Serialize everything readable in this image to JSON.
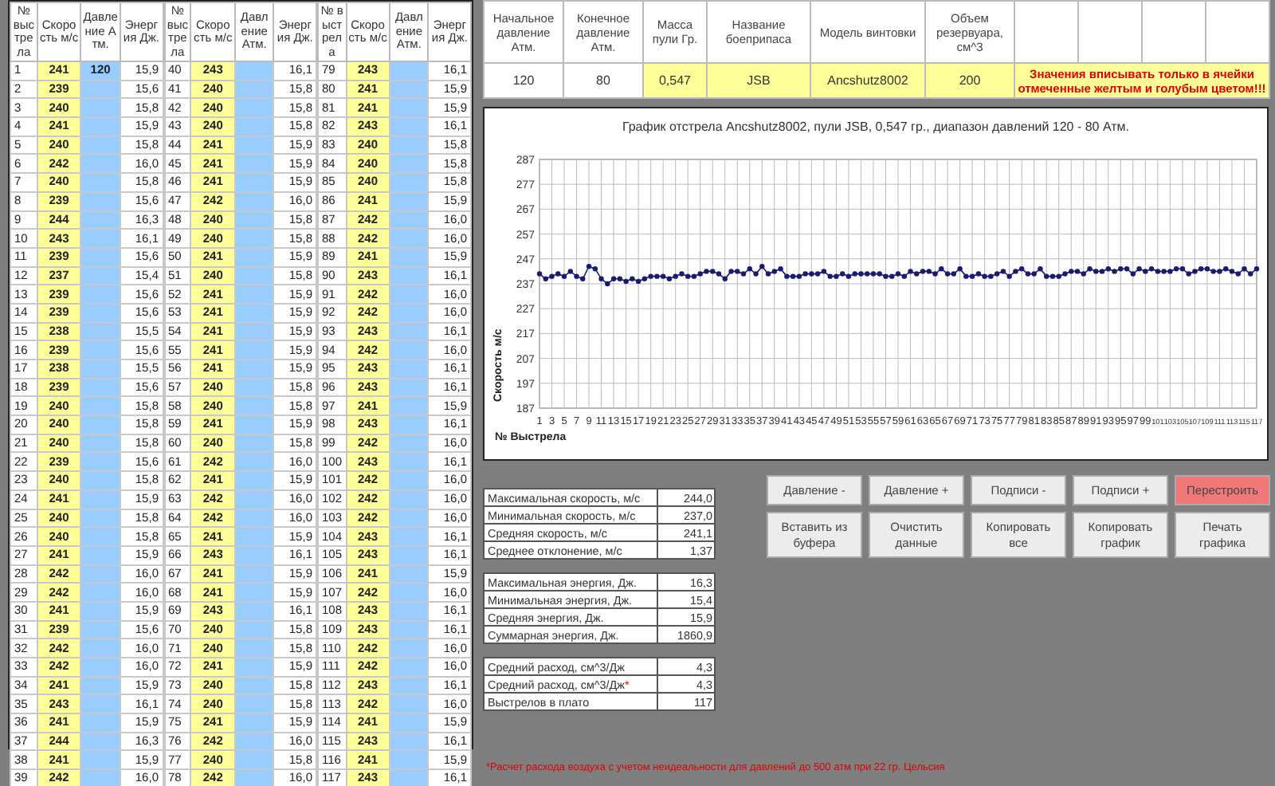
{
  "shot_table": {
    "groups": [
      {
        "columns": [
          {
            "label": "№ выстрела",
            "kind": "number"
          },
          {
            "label": "Скорость м/с",
            "kind": "speed",
            "color": "#ffff99"
          },
          {
            "label": "Давление Атм.",
            "kind": "pressure",
            "color": "#99ccff"
          },
          {
            "label": "Энергия Дж.",
            "kind": "energy"
          }
        ],
        "rows": [
          {
            "no": "1",
            "speed": "241",
            "pressure": "120",
            "energy": "15,9"
          },
          {
            "no": "2",
            "speed": "239",
            "energy": "15,6"
          },
          {
            "no": "3",
            "speed": "240",
            "energy": "15,8"
          },
          {
            "no": "4",
            "speed": "241",
            "energy": "15,9"
          },
          {
            "no": "5",
            "speed": "240",
            "energy": "15,8"
          },
          {
            "no": "6",
            "speed": "242",
            "energy": "16,0"
          },
          {
            "no": "7",
            "speed": "240",
            "energy": "15,8"
          },
          {
            "no": "8",
            "speed": "239",
            "energy": "15,6"
          },
          {
            "no": "9",
            "speed": "244",
            "energy": "16,3"
          },
          {
            "no": "10",
            "speed": "243",
            "energy": "16,1"
          },
          {
            "no": "11",
            "speed": "239",
            "energy": "15,6"
          },
          {
            "no": "12",
            "speed": "237",
            "energy": "15,4"
          },
          {
            "no": "13",
            "speed": "239",
            "energy": "15,6"
          },
          {
            "no": "14",
            "speed": "239",
            "energy": "15,6"
          },
          {
            "no": "15",
            "speed": "238",
            "energy": "15,5"
          },
          {
            "no": "16",
            "speed": "239",
            "energy": "15,6"
          },
          {
            "no": "17",
            "speed": "238",
            "energy": "15,5"
          },
          {
            "no": "18",
            "speed": "239",
            "energy": "15,6"
          },
          {
            "no": "19",
            "speed": "240",
            "energy": "15,8"
          },
          {
            "no": "20",
            "speed": "240",
            "energy": "15,8"
          },
          {
            "no": "21",
            "speed": "240",
            "energy": "15,8"
          },
          {
            "no": "22",
            "speed": "239",
            "energy": "15,6"
          },
          {
            "no": "23",
            "speed": "240",
            "energy": "15,8"
          },
          {
            "no": "24",
            "speed": "241",
            "energy": "15,9"
          },
          {
            "no": "25",
            "speed": "240",
            "energy": "15,8"
          },
          {
            "no": "26",
            "speed": "240",
            "energy": "15,8"
          },
          {
            "no": "27",
            "speed": "241",
            "energy": "15,9"
          },
          {
            "no": "28",
            "speed": "242",
            "energy": "16,0"
          },
          {
            "no": "29",
            "speed": "242",
            "energy": "16,0"
          },
          {
            "no": "30",
            "speed": "241",
            "energy": "15,9"
          },
          {
            "no": "31",
            "speed": "239",
            "energy": "15,6"
          },
          {
            "no": "32",
            "speed": "242",
            "energy": "16,0"
          },
          {
            "no": "33",
            "speed": "242",
            "energy": "16,0"
          },
          {
            "no": "34",
            "speed": "241",
            "energy": "15,9"
          },
          {
            "no": "35",
            "speed": "243",
            "energy": "16,1"
          },
          {
            "no": "36",
            "speed": "241",
            "energy": "15,9"
          },
          {
            "no": "37",
            "speed": "244",
            "energy": "16,3"
          },
          {
            "no": "38",
            "speed": "241",
            "energy": "15,9"
          },
          {
            "no": "39",
            "speed": "242",
            "energy": "16,0"
          }
        ]
      },
      {
        "columns": [
          {
            "label": "№ выстрела",
            "kind": "number"
          },
          {
            "label": "Скорость м/с",
            "kind": "speed",
            "color": "#ffff99"
          },
          {
            "label": "Давление Атм.",
            "kind": "pressure",
            "color": "#99ccff"
          },
          {
            "label": "Энергия Дж.",
            "kind": "energy"
          }
        ],
        "rows": [
          {
            "no": "40",
            "speed": "243",
            "energy": "16,1"
          },
          {
            "no": "41",
            "speed": "240",
            "energy": "15,8"
          },
          {
            "no": "42",
            "speed": "240",
            "energy": "15,8"
          },
          {
            "no": "43",
            "speed": "240",
            "energy": "15,8"
          },
          {
            "no": "44",
            "speed": "241",
            "energy": "15,9"
          },
          {
            "no": "45",
            "speed": "241",
            "energy": "15,9"
          },
          {
            "no": "46",
            "speed": "241",
            "energy": "15,9"
          },
          {
            "no": "47",
            "speed": "242",
            "energy": "16,0"
          },
          {
            "no": "48",
            "speed": "240",
            "energy": "15,8"
          },
          {
            "no": "49",
            "speed": "240",
            "energy": "15,8"
          },
          {
            "no": "50",
            "speed": "241",
            "energy": "15,9"
          },
          {
            "no": "51",
            "speed": "240",
            "energy": "15,8"
          },
          {
            "no": "52",
            "speed": "241",
            "energy": "15,9"
          },
          {
            "no": "53",
            "speed": "241",
            "energy": "15,9"
          },
          {
            "no": "54",
            "speed": "241",
            "energy": "15,9"
          },
          {
            "no": "55",
            "speed": "241",
            "energy": "15,9"
          },
          {
            "no": "56",
            "speed": "241",
            "energy": "15,9"
          },
          {
            "no": "57",
            "speed": "240",
            "energy": "15,8"
          },
          {
            "no": "58",
            "speed": "240",
            "energy": "15,8"
          },
          {
            "no": "59",
            "speed": "241",
            "energy": "15,9"
          },
          {
            "no": "60",
            "speed": "240",
            "energy": "15,8"
          },
          {
            "no": "61",
            "speed": "242",
            "energy": "16,0"
          },
          {
            "no": "62",
            "speed": "241",
            "energy": "15,9"
          },
          {
            "no": "63",
            "speed": "242",
            "energy": "16,0"
          },
          {
            "no": "64",
            "speed": "242",
            "energy": "16,0"
          },
          {
            "no": "65",
            "speed": "241",
            "energy": "15,9"
          },
          {
            "no": "66",
            "speed": "243",
            "energy": "16,1"
          },
          {
            "no": "67",
            "speed": "241",
            "energy": "15,9"
          },
          {
            "no": "68",
            "speed": "241",
            "energy": "15,9"
          },
          {
            "no": "69",
            "speed": "243",
            "energy": "16,1"
          },
          {
            "no": "70",
            "speed": "240",
            "energy": "15,8"
          },
          {
            "no": "71",
            "speed": "240",
            "energy": "15,8"
          },
          {
            "no": "72",
            "speed": "241",
            "energy": "15,9"
          },
          {
            "no": "73",
            "speed": "240",
            "energy": "15,8"
          },
          {
            "no": "74",
            "speed": "240",
            "energy": "15,8"
          },
          {
            "no": "75",
            "speed": "241",
            "energy": "15,9"
          },
          {
            "no": "76",
            "speed": "242",
            "energy": "16,0"
          },
          {
            "no": "77",
            "speed": "240",
            "energy": "15,8"
          },
          {
            "no": "78",
            "speed": "242",
            "energy": "16,0"
          }
        ]
      },
      {
        "columns": [
          {
            "label": "№ выстрела",
            "kind": "number"
          },
          {
            "label": "Скорость м/с",
            "kind": "speed",
            "color": "#ffff99"
          },
          {
            "label": "Давление Атм.",
            "kind": "pressure",
            "color": "#99ccff"
          },
          {
            "label": "Энергия Дж.",
            "kind": "energy"
          }
        ],
        "rows": [
          {
            "no": "79",
            "speed": "243",
            "energy": "16,1"
          },
          {
            "no": "80",
            "speed": "241",
            "energy": "15,9"
          },
          {
            "no": "81",
            "speed": "241",
            "energy": "15,9"
          },
          {
            "no": "82",
            "speed": "243",
            "energy": "16,1"
          },
          {
            "no": "83",
            "speed": "240",
            "energy": "15,8"
          },
          {
            "no": "84",
            "speed": "240",
            "energy": "15,8"
          },
          {
            "no": "85",
            "speed": "240",
            "energy": "15,8"
          },
          {
            "no": "86",
            "speed": "241",
            "energy": "15,9"
          },
          {
            "no": "87",
            "speed": "242",
            "energy": "16,0"
          },
          {
            "no": "88",
            "speed": "242",
            "energy": "16,0"
          },
          {
            "no": "89",
            "speed": "241",
            "energy": "15,9"
          },
          {
            "no": "90",
            "speed": "243",
            "energy": "16,1"
          },
          {
            "no": "91",
            "speed": "242",
            "energy": "16,0"
          },
          {
            "no": "92",
            "speed": "242",
            "energy": "16,0"
          },
          {
            "no": "93",
            "speed": "243",
            "energy": "16,1"
          },
          {
            "no": "94",
            "speed": "242",
            "energy": "16,0"
          },
          {
            "no": "95",
            "speed": "243",
            "energy": "16,1"
          },
          {
            "no": "96",
            "speed": "243",
            "energy": "16,1"
          },
          {
            "no": "97",
            "speed": "241",
            "energy": "15,9"
          },
          {
            "no": "98",
            "speed": "243",
            "energy": "16,1"
          },
          {
            "no": "99",
            "speed": "242",
            "energy": "16,0"
          },
          {
            "no": "100",
            "speed": "243",
            "energy": "16,1"
          },
          {
            "no": "101",
            "speed": "242",
            "energy": "16,0"
          },
          {
            "no": "102",
            "speed": "242",
            "energy": "16,0"
          },
          {
            "no": "103",
            "speed": "242",
            "energy": "16,0"
          },
          {
            "no": "104",
            "speed": "243",
            "energy": "16,1"
          },
          {
            "no": "105",
            "speed": "243",
            "energy": "16,1"
          },
          {
            "no": "106",
            "speed": "241",
            "energy": "15,9"
          },
          {
            "no": "107",
            "speed": "242",
            "energy": "16,0"
          },
          {
            "no": "108",
            "speed": "243",
            "energy": "16,1"
          },
          {
            "no": "109",
            "speed": "243",
            "energy": "16,1"
          },
          {
            "no": "110",
            "speed": "242",
            "energy": "16,0"
          },
          {
            "no": "111",
            "speed": "242",
            "energy": "16,0"
          },
          {
            "no": "112",
            "speed": "243",
            "energy": "16,1"
          },
          {
            "no": "113",
            "speed": "242",
            "energy": "16,0"
          },
          {
            "no": "114",
            "speed": "241",
            "energy": "15,9"
          },
          {
            "no": "115",
            "speed": "243",
            "energy": "16,1"
          },
          {
            "no": "116",
            "speed": "241",
            "energy": "15,9"
          },
          {
            "no": "117",
            "speed": "243",
            "energy": "16,1"
          }
        ]
      }
    ]
  },
  "params_table": {
    "columns": [
      {
        "label": "Начальное давление Атм.",
        "value": "120"
      },
      {
        "label": "Конечное давление Атм.",
        "value": "80"
      },
      {
        "label": "Масса пули Гр.",
        "value": "0,547",
        "color": "#ffff99"
      },
      {
        "label": "Название боеприпаса",
        "value": "JSB",
        "color": "#ffff99"
      },
      {
        "label": "Модель винтовки",
        "value": "Ancshutz8002",
        "color": "#ffff99"
      },
      {
        "label": "Объем резервуара, см^3",
        "value": "200",
        "color": "#ffff99"
      }
    ],
    "note": "Значения вписывать только в ячейки отмеченные желтым и голубым цветом!!!"
  },
  "chart": {
    "chart_data": {
      "type": "line",
      "title": "График отстрела Ancshutz8002, пули JSB, 0,547 гр., диапазон давлений 120 - 80 Атм.",
      "xlabel": "№ Выстрела",
      "ylabel": "Скорость м/с",
      "xlim": [
        1,
        117
      ],
      "ylim": [
        187,
        287
      ],
      "grid": true,
      "yticks": [
        187,
        197,
        207,
        217,
        227,
        237,
        247,
        257,
        267,
        277,
        287
      ],
      "x": [
        1,
        2,
        3,
        4,
        5,
        6,
        7,
        8,
        9,
        10,
        11,
        12,
        13,
        14,
        15,
        16,
        17,
        18,
        19,
        20,
        21,
        22,
        23,
        24,
        25,
        26,
        27,
        28,
        29,
        30,
        31,
        32,
        33,
        34,
        35,
        36,
        37,
        38,
        39,
        40,
        41,
        42,
        43,
        44,
        45,
        46,
        47,
        48,
        49,
        50,
        51,
        52,
        53,
        54,
        55,
        56,
        57,
        58,
        59,
        60,
        61,
        62,
        63,
        64,
        65,
        66,
        67,
        68,
        69,
        70,
        71,
        72,
        73,
        74,
        75,
        76,
        77,
        78,
        79,
        80,
        81,
        82,
        83,
        84,
        85,
        86,
        87,
        88,
        89,
        90,
        91,
        92,
        93,
        94,
        95,
        96,
        97,
        98,
        99,
        100,
        101,
        102,
        103,
        104,
        105,
        106,
        107,
        108,
        109,
        110,
        111,
        112,
        113,
        114,
        115,
        116,
        117
      ],
      "xticks": [
        1,
        3,
        5,
        7,
        9,
        11,
        13,
        15,
        17,
        19,
        21,
        23,
        25,
        27,
        29,
        31,
        33,
        35,
        37,
        39,
        41,
        43,
        45,
        47,
        49,
        51,
        53,
        55,
        57,
        59,
        61,
        63,
        65,
        67,
        69,
        71,
        73,
        75,
        77,
        79,
        81,
        83,
        85,
        87,
        89,
        91,
        93,
        95,
        97,
        99,
        101,
        103,
        105,
        107,
        109,
        111,
        113,
        115,
        117
      ],
      "series": [
        {
          "color": "#1a1a70",
          "marker": "circle",
          "values": [
            241,
            239,
            240,
            241,
            240,
            242,
            240,
            239,
            244,
            243,
            239,
            237,
            239,
            239,
            238,
            239,
            238,
            239,
            240,
            240,
            240,
            239,
            240,
            241,
            240,
            240,
            241,
            242,
            242,
            241,
            239,
            242,
            242,
            241,
            243,
            241,
            244,
            241,
            242,
            243,
            240,
            240,
            240,
            241,
            241,
            241,
            242,
            240,
            240,
            241,
            240,
            241,
            241,
            241,
            241,
            241,
            240,
            240,
            241,
            240,
            242,
            241,
            242,
            242,
            241,
            243,
            241,
            241,
            243,
            240,
            240,
            241,
            240,
            240,
            241,
            242,
            240,
            242,
            243,
            241,
            241,
            243,
            240,
            240,
            240,
            241,
            242,
            242,
            241,
            243,
            242,
            242,
            243,
            242,
            243,
            243,
            241,
            243,
            242,
            243,
            242,
            242,
            242,
            243,
            243,
            241,
            242,
            243,
            243,
            242,
            242,
            243,
            242,
            241,
            243,
            241,
            243
          ]
        }
      ]
    }
  },
  "stats": [
    {
      "rows": [
        {
          "label": "Максимальная скорость, м/с",
          "value": "244,0"
        },
        {
          "label": "Минимальная скорость, м/с",
          "value": "237,0"
        },
        {
          "label": "Средняя скорость, м/с",
          "value": "241,1"
        },
        {
          "label": "Среднее отклонение, м/с",
          "value": "1,37"
        }
      ]
    },
    {
      "rows": [
        {
          "label": "Максимальная энергия, Дж.",
          "value": "16,3"
        },
        {
          "label": "Минимальная энергия, Дж.",
          "value": "15,4"
        },
        {
          "label": "Средняя энергия, Дж.",
          "value": "15,9"
        },
        {
          "label": "Суммарная энергия, Дж.",
          "value": "1860,9"
        }
      ]
    },
    {
      "rows": [
        {
          "label": "Средний расход, см^3/Дж",
          "value": "4,3"
        },
        {
          "label": "Средний расход, см^3/Дж",
          "footnote_mark": "*",
          "value": "4,3"
        },
        {
          "label": "Выстрелов в плато",
          "value": "117"
        }
      ]
    }
  ],
  "buttons": [
    {
      "label": "Давление -",
      "highlighted": false
    },
    {
      "label": "Давление +",
      "highlighted": false
    },
    {
      "label": "Подписи -",
      "highlighted": false
    },
    {
      "label": "Подписи +",
      "highlighted": false
    },
    {
      "label": "Перестроить",
      "highlighted": true
    },
    {
      "label": "Вставить из буфера",
      "highlighted": false
    },
    {
      "label": "Очистить данные",
      "highlighted": false
    },
    {
      "label": "Копировать все",
      "highlighted": false
    },
    {
      "label": "Копировать график",
      "highlighted": false
    },
    {
      "label": "Печать графика",
      "highlighted": false
    }
  ],
  "footnote": "*Расчет расхода воздуха с учетом неидеальности для давлений до 500 атм при 22 гр. Цельсия"
}
